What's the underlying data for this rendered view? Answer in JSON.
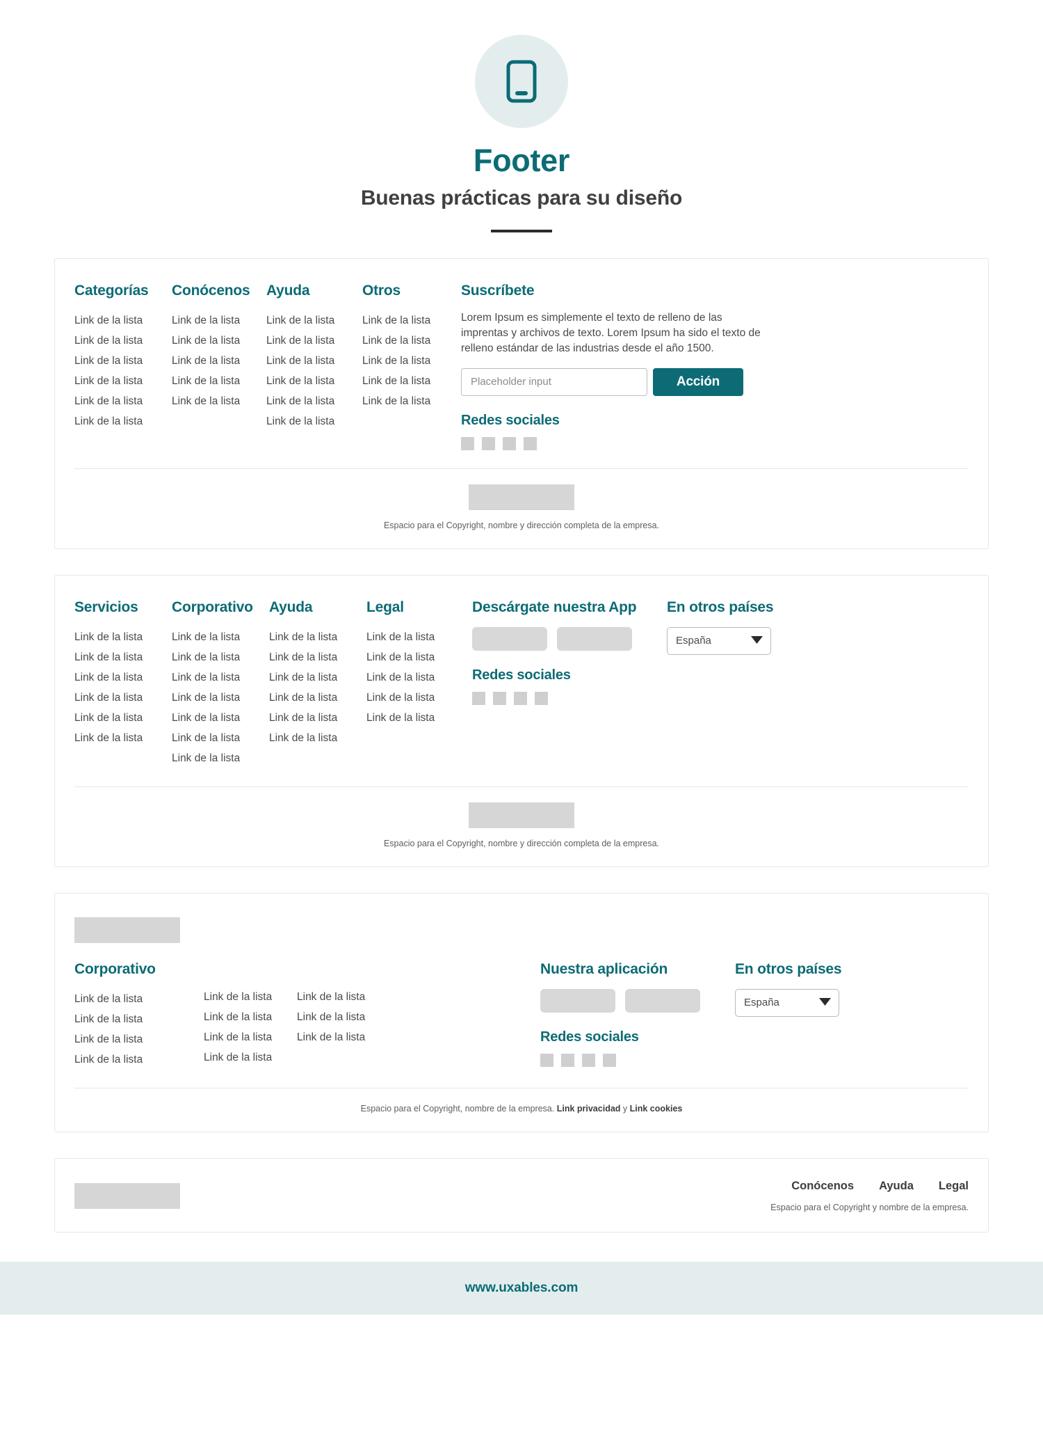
{
  "header": {
    "icon": "mobile-phone-icon",
    "title": "Footer",
    "subtitle": "Buenas prácticas para su diseño"
  },
  "link_label": "Link de la lista",
  "colors": {
    "accent": "#0c6b75",
    "accent_soft": "#e4edee",
    "placeholder_gray": "#d6d6d6",
    "text": "#4a4a4a"
  },
  "card1": {
    "columns": [
      {
        "head": "Categorías",
        "count": 6
      },
      {
        "head": "Conócenos",
        "count": 5
      },
      {
        "head": "Ayuda",
        "count": 6
      },
      {
        "head": "Otros",
        "count": 5
      }
    ],
    "subscribe": {
      "head": "Suscríbete",
      "paragraph": "Lorem Ipsum es simplemente el texto de relleno de las imprentas y archivos de texto. Lorem Ipsum ha sido el texto de relleno estándar de las industrias desde el año 1500.",
      "input_placeholder": "Placeholder input",
      "input_value": "",
      "button_label": "Acción"
    },
    "social": {
      "head": "Redes sociales",
      "count": 4
    },
    "copyright": "Espacio para el Copyright, nombre y dirección completa de la empresa."
  },
  "card2": {
    "columns": [
      {
        "head": "Servicios",
        "count": 6
      },
      {
        "head": "Corporativo",
        "count": 7
      },
      {
        "head": "Ayuda",
        "count": 6
      },
      {
        "head": "Legal",
        "count": 5
      }
    ],
    "app": {
      "head": "Descárgate nuestra App",
      "badges": 2
    },
    "social": {
      "head": "Redes sociales",
      "count": 4
    },
    "country": {
      "head": "En otros países",
      "selected": "España",
      "options": [
        "España"
      ]
    },
    "copyright": "Espacio para el Copyright, nombre y dirección completa de la empresa."
  },
  "card3": {
    "brand_head": "Corporativo",
    "columns": [
      {
        "head": "",
        "count": 4
      },
      {
        "head": "",
        "count": 4
      },
      {
        "head": "",
        "count": 3
      }
    ],
    "app": {
      "head": "Nuestra aplicación",
      "badges": 2
    },
    "social": {
      "head": "Redes sociales",
      "count": 4
    },
    "country": {
      "head": "En otros países",
      "selected": "España",
      "options": [
        "España"
      ]
    },
    "copyright_text": "Espacio para el Copyright, nombre de la empresa.",
    "copyright_link1": "Link privacidad",
    "copyright_joiner": "y",
    "copyright_link2": "Link cookies"
  },
  "card4": {
    "nav": [
      "Conócenos",
      "Ayuda",
      "Legal"
    ],
    "copyright": "Espacio para el Copyright y nombre de la empresa."
  },
  "site_footer": {
    "url": "www.uxables.com"
  }
}
